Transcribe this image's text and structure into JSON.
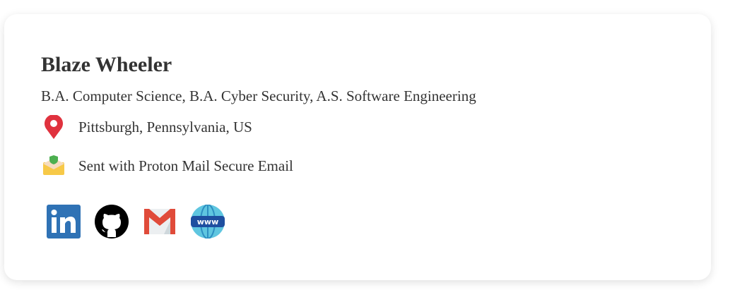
{
  "name": "Blaze Wheeler",
  "degrees": "B.A. Computer Science, B.A. Cyber Security, A.S. Software Engineering",
  "location": "Pittsburgh, Pennsylvania, US",
  "mail_note": "Sent with Proton Mail Secure Email",
  "social": [
    {
      "icon": "linkedin-icon"
    },
    {
      "icon": "github-icon"
    },
    {
      "icon": "gmail-icon"
    },
    {
      "icon": "website-icon"
    }
  ]
}
